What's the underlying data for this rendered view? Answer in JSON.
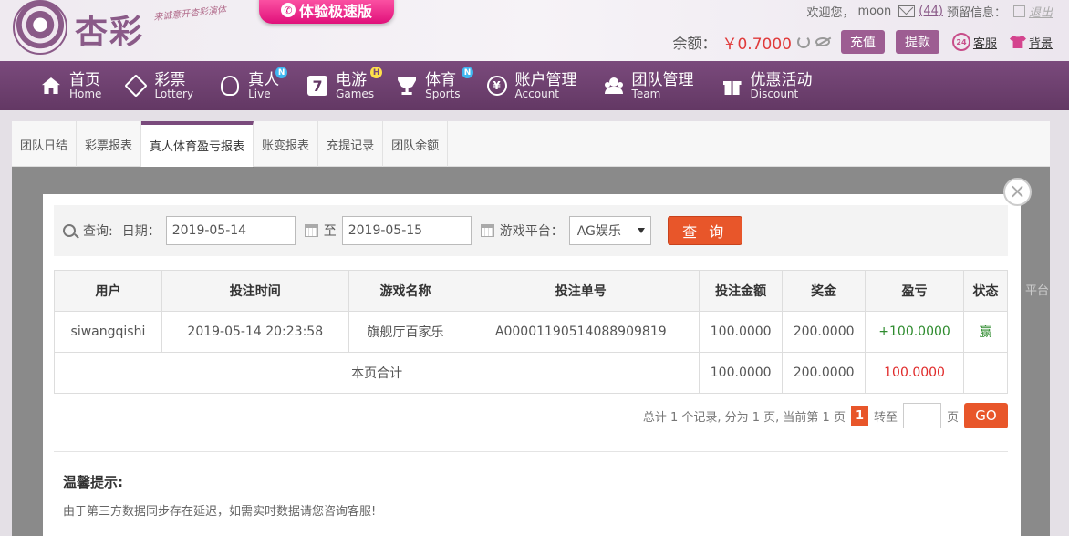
{
  "header": {
    "logo_text": "杏彩",
    "slogan": "来诚意开杏彩演体",
    "promo_label": "体验极速版",
    "welcome": "欢迎您，",
    "username": "moon",
    "mail_count": "(44)",
    "prefs_label": "预留信息：",
    "logout": "退出",
    "balance_label": "余额：",
    "balance_value": "￥0.7000",
    "recharge": "充值",
    "withdraw": "提款",
    "customer_service": "客服",
    "background": "背景"
  },
  "nav": [
    {
      "zh": "首页",
      "en": "Home",
      "icon": "home-icon",
      "badge": ""
    },
    {
      "zh": "彩票",
      "en": "Lottery",
      "icon": "lottery-icon",
      "badge": ""
    },
    {
      "zh": "真人",
      "en": "Live",
      "icon": "live-icon",
      "badge": "N"
    },
    {
      "zh": "电游",
      "en": "Games",
      "icon": "games-icon",
      "badge": "H"
    },
    {
      "zh": "体育",
      "en": "Sports",
      "icon": "sports-icon",
      "badge": "N"
    },
    {
      "zh": "账户管理",
      "en": "Account",
      "icon": "account-icon",
      "badge": ""
    },
    {
      "zh": "团队管理",
      "en": "Team",
      "icon": "team-icon",
      "badge": ""
    },
    {
      "zh": "优惠活动",
      "en": "Discount",
      "icon": "gift-icon",
      "badge": ""
    }
  ],
  "tabs": [
    "团队日结",
    "彩票报表",
    "真人体育盈亏报表",
    "账变报表",
    "充提记录",
    "团队余额"
  ],
  "active_tab": 2,
  "background_label": "平台",
  "query": {
    "label": "查询:",
    "date_label": "日期：",
    "start_date": "2019-05-14",
    "to_label": "至",
    "end_date": "2019-05-15",
    "platform_label": "游戏平台：",
    "platform_value": "AG娱乐",
    "submit": "查 询"
  },
  "table": {
    "headers": [
      "用户",
      "投注时间",
      "游戏名称",
      "投注单号",
      "投注金额",
      "奖金",
      "盈亏",
      "状态"
    ],
    "rows": [
      [
        "siwangqishi",
        "2019-05-14 20:23:58",
        "旗舰厅百家乐",
        "A00001190514088909819",
        "100.0000",
        "200.0000",
        "+100.0000",
        "赢"
      ]
    ],
    "summary": {
      "label": "本页合计",
      "bet": "100.0000",
      "prize": "200.0000",
      "profit": "100.0000"
    }
  },
  "pager": {
    "summary": "总计 1 个记录, 分为 1 页, 当前第 1 页",
    "current": "1",
    "goto_label": "转至",
    "page_unit": "页",
    "go": "GO"
  },
  "tip": {
    "title": "温馨提示:",
    "text": "由于第三方数据同步存在延迟，如需实时数据请您咨询客服!"
  },
  "colors": {
    "brand": "#7a4a7c",
    "accent": "#e8562a",
    "win": "#2e8b2e",
    "loss": "#e02a2a"
  }
}
